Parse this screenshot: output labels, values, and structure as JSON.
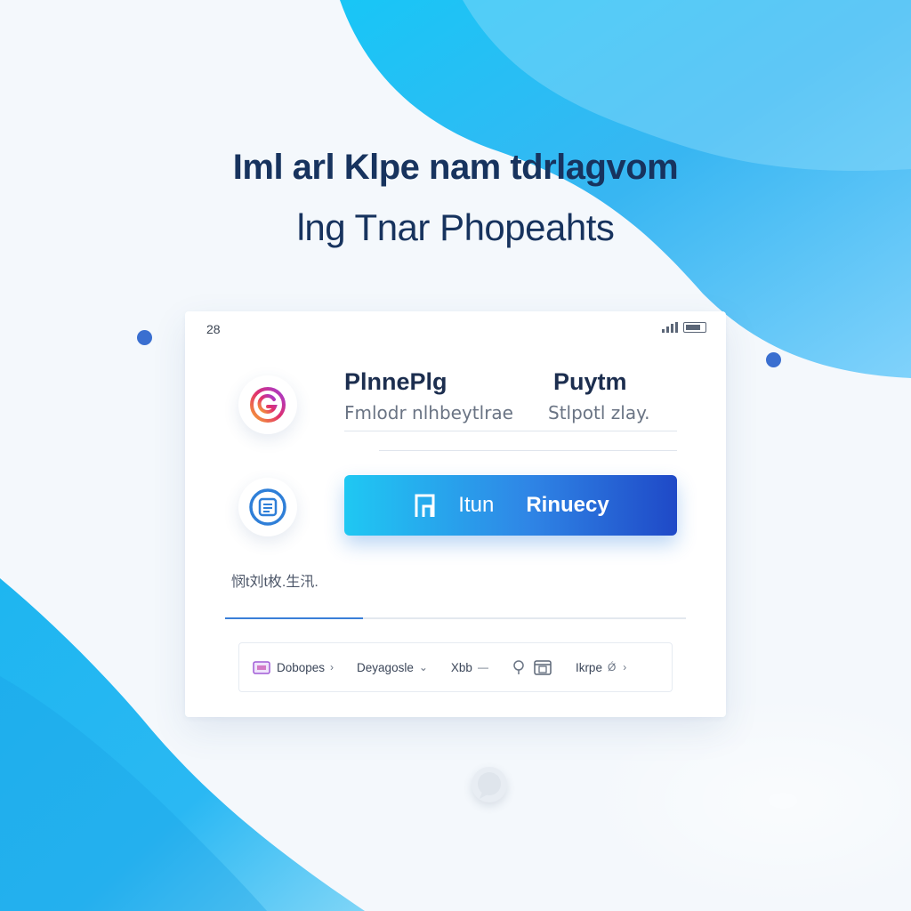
{
  "colors": {
    "accent_start": "#1fc8f3",
    "accent_end": "#1f49c7",
    "headline": "#17335e",
    "blob_light": "#7ed8f7",
    "blob_deep": "#1aa8ee",
    "dot": "#3a6fd0"
  },
  "hero": {
    "line1": "Iml arl Klpe nam tdrlagvom",
    "line2": "lng Tnar Phopeahts"
  },
  "status_bar": {
    "time": "28",
    "signal_icon": "signal-icon",
    "battery_icon": "battery-icon"
  },
  "form": {
    "row1": {
      "icon": "instagram-g-icon",
      "left_title": "PlnnePlg",
      "right_title": "Puytm",
      "left_sub": "Fmlodr nlhbeytlrae",
      "right_sub": "Stlpotl zlay."
    },
    "row2": {
      "icon": "document-icon",
      "button_icon": "n-icon",
      "button_label_a": "Itun",
      "button_label_b": "Rinuecy"
    },
    "caption": "悯t刘t枚.生汛.",
    "progress": 0.3
  },
  "toolbar": {
    "items": [
      {
        "icon": "folder-icon",
        "label": "Dobopes",
        "chevron": "›"
      },
      {
        "label": "Deyagosle",
        "chevron": "⌄"
      },
      {
        "label": "Xbb",
        "chevron": "—"
      },
      {
        "icon": "pin-icon"
      },
      {
        "icon": "calendar-icon"
      },
      {
        "label": "Ikrpe",
        "chevron": "Ǿ"
      },
      {
        "chevron": "›"
      }
    ]
  },
  "chat": {
    "icon": "chat-bubble-icon"
  }
}
